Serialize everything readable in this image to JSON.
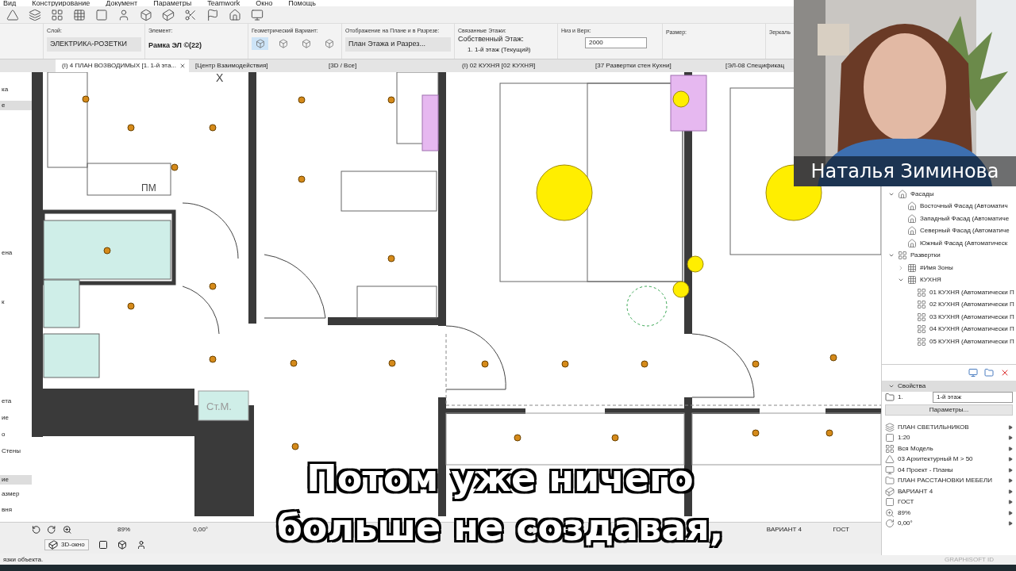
{
  "menu": [
    "Вид",
    "Конструирование",
    "Документ",
    "Параметры",
    "Teamwork",
    "Окно",
    "Помощь"
  ],
  "info_box": {
    "layer": {
      "label": "Слой:",
      "value": "ЭЛЕКТРИКА-РОЗЕТКИ"
    },
    "element": {
      "label": "Элемент:",
      "value": "Рамка ЭЛ ©(22)"
    },
    "geometry": {
      "label": "Геометрический Вариант:",
      "options": [
        {
          "selected": true
        },
        {
          "selected": false
        },
        {
          "selected": false
        },
        {
          "selected": false
        }
      ]
    },
    "display": {
      "label": "Отображение на Плане и в Разрезе:",
      "value": "План Этажа и Разрез..."
    },
    "stories": {
      "label": "Связанные Этажи:",
      "sublabel": "Собственный Этаж:",
      "value": "1. 1-й этаж (Текущий)"
    },
    "height": {
      "label": "Низ и Верх:",
      "value": "2000"
    },
    "size": {
      "label": "Размер:"
    },
    "mirror": {
      "label": "Зеркаль"
    }
  },
  "tabs": [
    {
      "label": "(I) 4 ПЛАН ВОЗВОДИМЫХ [1. 1-й эта...",
      "selected": true,
      "closable": true
    },
    {
      "label": "[Центр Взаимодействия]",
      "selected": false,
      "closable": false
    },
    {
      "label": "[3D / Все]",
      "selected": false,
      "closable": false
    },
    {
      "label": "(I) 02 КУХНЯ [02 КУХНЯ]",
      "selected": false,
      "closable": false
    },
    {
      "label": "[37 Развертки стен Кухни]",
      "selected": false,
      "closable": false
    },
    {
      "label": "[ЭЛ-08 Спецификац",
      "selected": false,
      "closable": false
    }
  ],
  "left_panel": [
    {
      "label": "ка",
      "selected": false
    },
    {
      "label": "е",
      "selected": true
    },
    {
      "label": "ена",
      "selected": false
    },
    {
      "label": "к",
      "selected": false
    },
    {
      "label": "ета",
      "selected": false
    },
    {
      "label": "ие",
      "selected": false
    },
    {
      "label": "о",
      "selected": false
    },
    {
      "label": "Стены",
      "selected": false
    },
    {
      "label": "ие",
      "selected": true
    },
    {
      "label": "азмер",
      "selected": false
    },
    {
      "label": "вня",
      "selected": false
    }
  ],
  "plan_labels": [
    "X",
    "ПМ",
    "Ст.М."
  ],
  "navigator": [
    {
      "label": "Фасады",
      "kind": "folder",
      "expanded": true,
      "children": [
        {
          "label": "Восточный Фасад (Автоматич",
          "kind": "elevation"
        },
        {
          "label": "Западный Фасад (Автоматиче",
          "kind": "elevation"
        },
        {
          "label": "Северный Фасад (Автоматиче",
          "kind": "elevation"
        },
        {
          "label": "Южный Фасад (Автоматическ",
          "kind": "elevation"
        }
      ]
    },
    {
      "label": "Развертки",
      "kind": "interior",
      "expanded": true,
      "children": [
        {
          "label": "#Имя Зоны",
          "kind": "zone",
          "expanded": false
        },
        {
          "label": "КУХНЯ",
          "kind": "zone",
          "expanded": true,
          "children": [
            {
              "label": "01 КУХНЯ (Автоматически П",
              "kind": "interior"
            },
            {
              "label": "02 КУХНЯ (Автоматически П",
              "kind": "interior"
            },
            {
              "label": "03 КУХНЯ (Автоматически П",
              "kind": "interior"
            },
            {
              "label": "04 КУХНЯ (Автоматически П",
              "kind": "interior"
            },
            {
              "label": "05 КУХНЯ (Автоматически П",
              "kind": "interior"
            }
          ]
        }
      ]
    }
  ],
  "properties": {
    "title": "Свойства",
    "expanded": true,
    "story_number": "1.",
    "story_name": "1-й этаж",
    "button": "Параметры...",
    "rows": [
      "ПЛАН СВЕТИЛЬНИКОВ",
      "1:20",
      "Вся Модель",
      "03 Архитектурный М > 50",
      "04 Проект - Планы",
      "ПЛАН РАССТАНОВКИ МЕБЕЛИ",
      "ВАРИАНТ 4",
      "ГОСТ",
      "89%",
      "0,00°"
    ]
  },
  "bottom_bar": {
    "zoom": "89%",
    "angle": "0,00°",
    "variant": "ВАРИАНТ 4",
    "standard": "ГОСТ",
    "view3d_button": "3D-окно"
  },
  "status_bar": {
    "message": "язки объекта.",
    "brand": "GRAPHISOFT ID"
  },
  "webcam": {
    "kind": "picture",
    "name": "Наталья Зиминова"
  },
  "subtitle": {
    "lines": [
      "Потом уже ничего",
      "больше не создавая,"
    ]
  }
}
